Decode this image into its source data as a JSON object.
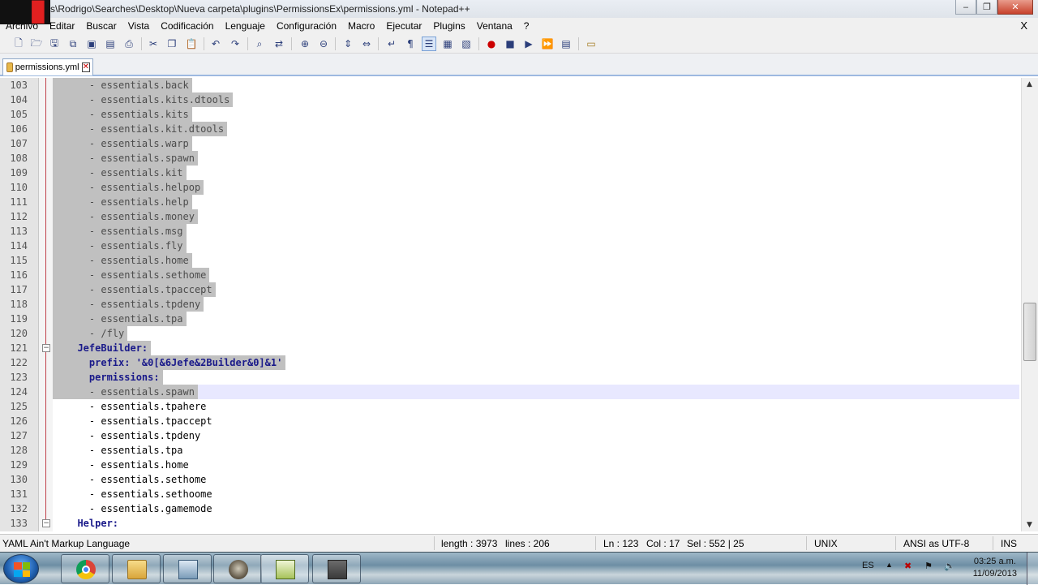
{
  "window": {
    "title": "s\\Rodrigo\\Searches\\Desktop\\Nueva carpeta\\plugins\\PermissionsEx\\permissions.yml - Notepad++",
    "min": "‒",
    "max": "❐",
    "close": "✕"
  },
  "menu": [
    "Archivo",
    "Editar",
    "Buscar",
    "Vista",
    "Codificación",
    "Lenguaje",
    "Configuración",
    "Macro",
    "Ejecutar",
    "Plugins",
    "Ventana",
    "?"
  ],
  "menu_close": "X",
  "toolbar_icons": [
    "new-file-icon",
    "open-file-icon",
    "save-icon",
    "save-all-icon",
    "close-icon",
    "close-all-icon",
    "print-icon",
    "cut-icon",
    "copy-icon",
    "paste-icon",
    "undo-icon",
    "redo-icon",
    "find-icon",
    "replace-icon",
    "zoom-in-icon",
    "zoom-out-icon",
    "sync-v-icon",
    "sync-h-icon",
    "word-wrap-icon",
    "show-all-chars-icon",
    "indent-guide-icon",
    "doc-map-icon",
    "function-list-icon",
    "macro-record-icon",
    "macro-stop-icon",
    "macro-play-icon",
    "macro-play-multi-icon",
    "macro-save-icon",
    "folder-workspace-icon"
  ],
  "tab": {
    "name": "permissions.yml",
    "close": "✕"
  },
  "editor": {
    "lines": [
      {
        "n": "103",
        "text": "    - essentials.back",
        "sel": true
      },
      {
        "n": "104",
        "text": "    - essentials.kits.dtools",
        "sel": true
      },
      {
        "n": "105",
        "text": "    - essentials.kits",
        "sel": true
      },
      {
        "n": "106",
        "text": "    - essentials.kit.dtools",
        "sel": true
      },
      {
        "n": "107",
        "text": "    - essentials.warp",
        "sel": true
      },
      {
        "n": "108",
        "text": "    - essentials.spawn",
        "sel": true
      },
      {
        "n": "109",
        "text": "    - essentials.kit",
        "sel": true
      },
      {
        "n": "110",
        "text": "    - essentials.helpop",
        "sel": true
      },
      {
        "n": "111",
        "text": "    - essentials.help",
        "sel": true
      },
      {
        "n": "112",
        "text": "    - essentials.money",
        "sel": true
      },
      {
        "n": "113",
        "text": "    - essentials.msg",
        "sel": true
      },
      {
        "n": "114",
        "text": "    - essentials.fly",
        "sel": true
      },
      {
        "n": "115",
        "text": "    - essentials.home",
        "sel": true
      },
      {
        "n": "116",
        "text": "    - essentials.sethome",
        "sel": true
      },
      {
        "n": "117",
        "text": "    - essentials.tpaccept",
        "sel": true
      },
      {
        "n": "118",
        "text": "    - essentials.tpdeny",
        "sel": true
      },
      {
        "n": "119",
        "text": "    - essentials.tpa",
        "sel": true
      },
      {
        "n": "120",
        "text": "    - /fly",
        "sel": true
      },
      {
        "n": "121",
        "text": "  JefeBuilder:",
        "sel": true,
        "key": true
      },
      {
        "n": "122",
        "text": "    prefix: '&0[&6Jefe&2Builder&0]&1'",
        "sel": true,
        "key": true
      },
      {
        "n": "123",
        "text": "    permissions:",
        "sel": true,
        "key": true
      },
      {
        "n": "124",
        "text": "    - essentials.spawn",
        "sel": true,
        "cur": true
      },
      {
        "n": "125",
        "text": "    - essentials.tpahere",
        "sel": false
      },
      {
        "n": "126",
        "text": "    - essentials.tpaccept",
        "sel": false
      },
      {
        "n": "127",
        "text": "    - essentials.tpdeny",
        "sel": false
      },
      {
        "n": "128",
        "text": "    - essentials.tpa",
        "sel": false
      },
      {
        "n": "129",
        "text": "    - essentials.home",
        "sel": false
      },
      {
        "n": "130",
        "text": "    - essentials.sethome",
        "sel": false
      },
      {
        "n": "131",
        "text": "    - essentials.sethoome",
        "sel": false
      },
      {
        "n": "132",
        "text": "    - essentials.gamemode",
        "sel": false
      },
      {
        "n": "133",
        "text": "  Helper:",
        "sel": false,
        "key": true
      }
    ]
  },
  "status": {
    "language": "YAML Ain't Markup Language",
    "length": "length : 3973",
    "lines": "lines : 206",
    "ln": "Ln : 123",
    "col": "Col : 17",
    "sel": "Sel : 552 | 25",
    "eol": "UNIX",
    "encoding": "ANSI as UTF-8",
    "mode": "INS"
  },
  "taskbar": {
    "apps": [
      "chrome-icon",
      "explorer-folder-icon",
      "control-panel-icon",
      "gimp-icon",
      "notepadpp-icon",
      "minecraft-server-icon"
    ],
    "lang": "ES",
    "time": "03:25 a.m.",
    "date": "11/09/2013"
  },
  "colors": {
    "selection": "#c0c0c0",
    "keyword": "#1a1a8a",
    "fold_line": "#c0404a"
  }
}
